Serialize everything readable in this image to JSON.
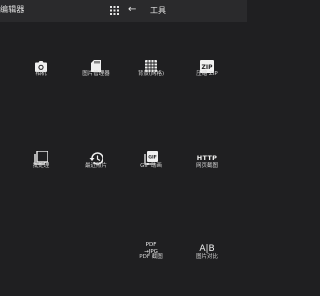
{
  "topbar": {
    "left_title": "编辑器",
    "grid_icon": "grid-icon",
    "back_icon": "←",
    "title": "工具"
  },
  "tiles": [
    {
      "label": "相机",
      "icon": "camera-icon"
    },
    {
      "label": "图片管理器",
      "icon": "sd-card-icon"
    },
    {
      "label": "背景(网格)",
      "icon": "grid-pattern-icon"
    },
    {
      "label": "压缩 ZIP",
      "icon": "zip-file-icon"
    },
    {
      "label": "批处理",
      "icon": "batch-icon"
    },
    {
      "label": "最近照片",
      "icon": "history-icon"
    },
    {
      "label": "GIF 动画",
      "icon": "gif-icon"
    },
    {
      "label": "网页截图",
      "icon": "http-icon",
      "icon_text": "HTTP"
    },
    {
      "label": "PDF 截图",
      "icon": "pdf-to-jpg-icon",
      "icon_text_1": "PDF",
      "icon_text_2": "→JPG"
    },
    {
      "label": "图片对比",
      "icon": "compare-icon",
      "icon_text": "A|B"
    }
  ]
}
